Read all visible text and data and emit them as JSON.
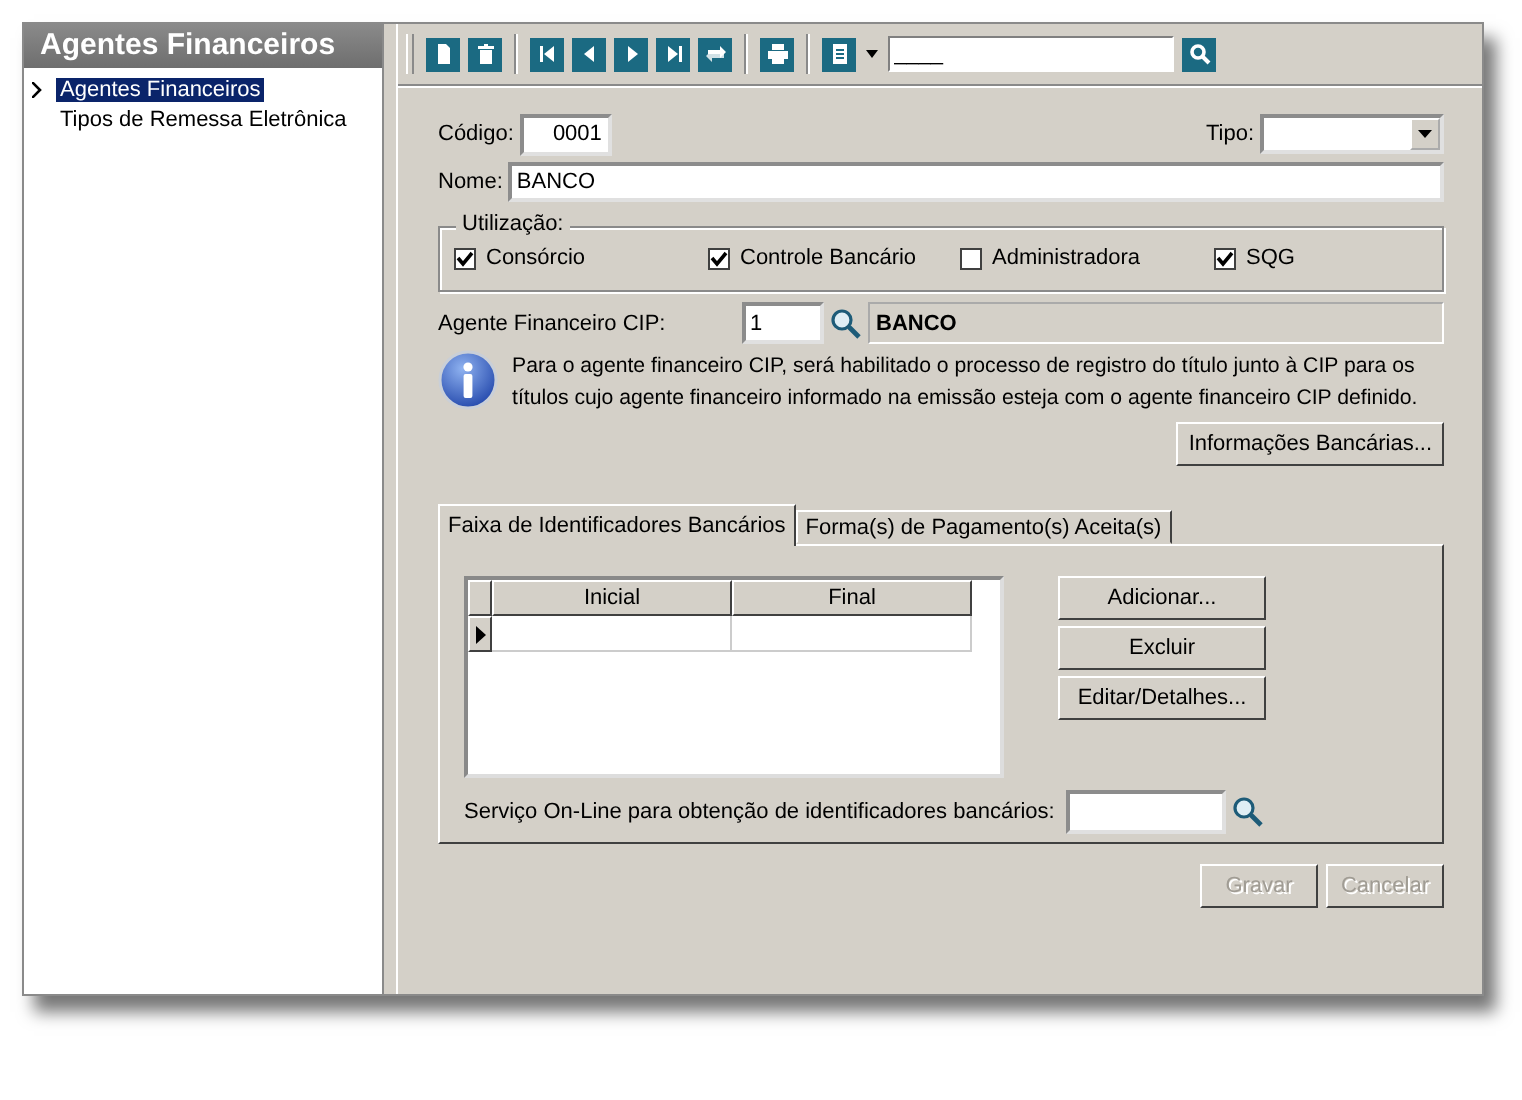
{
  "sidebar": {
    "title": "Agentes Financeiros",
    "items": [
      {
        "label": "Agentes Financeiros",
        "selected": true
      },
      {
        "label": "Tipos de Remessa Eletrônica",
        "selected": false
      }
    ]
  },
  "toolbar": {
    "search": {
      "value": "____"
    }
  },
  "form": {
    "codigo": {
      "label": "Código:",
      "value": "0001"
    },
    "tipo": {
      "label": "Tipo:"
    },
    "nome": {
      "label": "Nome:",
      "value": "BANCO"
    },
    "utilizacao": {
      "title": "Utilização:",
      "options": [
        {
          "label": "Consórcio",
          "checked": true
        },
        {
          "label": "Controle Bancário",
          "checked": true
        },
        {
          "label": "Administradora",
          "checked": false
        },
        {
          "label": "SQG",
          "checked": true
        }
      ]
    },
    "agente_cip": {
      "label": "Agente Financeiro CIP:",
      "value": "1",
      "name": "BANCO"
    },
    "info": "Para o agente financeiro CIP, será habilitado o processo de registro do título junto à CIP para os títulos cujo agente financeiro informado na emissão esteja com o agente financeiro CIP definido.",
    "info_button": "Informações Bancárias..."
  },
  "tabs": [
    {
      "label": "Faixa de Identificadores Bancários",
      "selected": true
    },
    {
      "label": "Forma(s) de Pagamento(s) Aceita(s)",
      "selected": false
    }
  ],
  "table": {
    "columns": [
      "Inicial",
      "Final"
    ],
    "rows": [
      [
        "",
        ""
      ]
    ]
  },
  "side_buttons": [
    "Adicionar...",
    "Excluir",
    "Editar/Detalhes..."
  ],
  "servico": {
    "label": "Serviço On-Line para obtenção de identificadores bancários:"
  },
  "footer_buttons": [
    {
      "label": "Gravar",
      "disabled": true
    },
    {
      "label": "Cancelar",
      "disabled": true
    }
  ]
}
